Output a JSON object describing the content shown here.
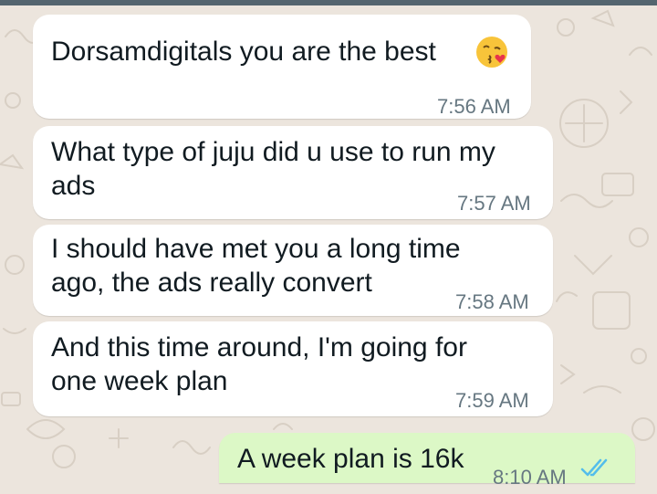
{
  "messages": [
    {
      "text": "Dorsamdigitals you are the best",
      "time": "7:56 AM",
      "emoji": "kissing-face-with-heart-icon"
    },
    {
      "text": "What type of juju did u use to run my\nads",
      "time": "7:57 AM"
    },
    {
      "text": "I should have met you a long time\nago, the ads really convert",
      "time": "7:58 AM"
    },
    {
      "text": "And this time around, I'm going for\none week plan",
      "time": "7:59 AM"
    }
  ],
  "outgoing": {
    "text": "A week plan is 16k",
    "time": "8:10 AM",
    "status": "read-double-tick-icon",
    "status_color": "#53bdeb"
  },
  "colors": {
    "incoming_bubble": "#ffffff",
    "outgoing_bubble": "#dcf8c6",
    "wallpaper": "#ece5dd",
    "timestamp": "#667781"
  }
}
